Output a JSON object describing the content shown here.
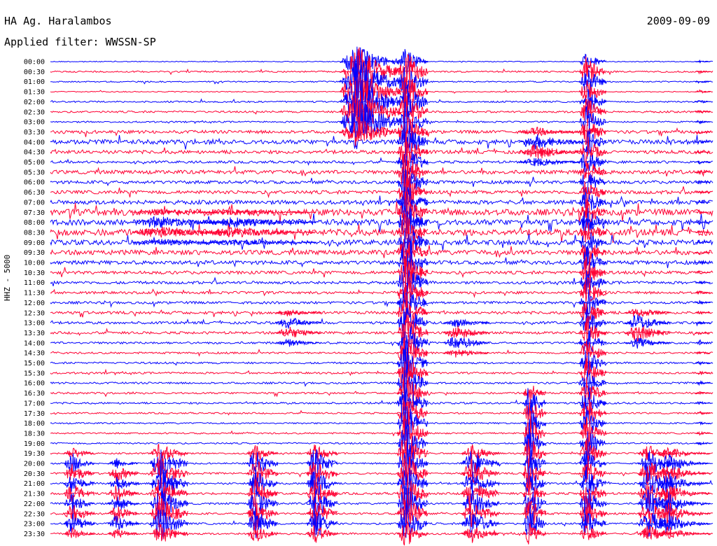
{
  "header": {
    "station": "HA Ag. Haralambos",
    "filter": "Applied filter: WWSSN-SP",
    "date": "2009-09-09"
  },
  "chart_data": {
    "type": "line",
    "title": "HA Ag. Haralambos",
    "subtitle": "Applied filter: WWSSN-SP",
    "ylabel": "HHZ - 5000",
    "date": "2009-09-09",
    "row_labels": [
      "00:00",
      "00:30",
      "01:00",
      "01:30",
      "02:00",
      "02:30",
      "03:00",
      "03:30",
      "04:00",
      "04:30",
      "05:00",
      "05:30",
      "06:00",
      "06:30",
      "07:00",
      "07:30",
      "08:00",
      "08:30",
      "09:00",
      "09:30",
      "10:00",
      "10:30",
      "11:00",
      "11:30",
      "12:00",
      "12:30",
      "13:00",
      "13:30",
      "14:00",
      "14:30",
      "15:00",
      "15:30",
      "16:00",
      "16:30",
      "17:00",
      "17:30",
      "18:00",
      "18:30",
      "19:00",
      "19:30",
      "20:00",
      "20:30",
      "21:00",
      "21:30",
      "22:00",
      "22:30",
      "23:00",
      "23:30"
    ],
    "row_minutes": 30,
    "x_range_minutes": [
      0,
      30
    ],
    "trace_colors": [
      "#0000ff",
      "#ff0033"
    ],
    "noise_level": [
      0.3,
      0.5,
      0.4,
      0.3,
      0.5,
      0.6,
      0.5,
      1.0,
      1.4,
      1.1,
      0.8,
      1.2,
      1.0,
      1.1,
      1.3,
      2.0,
      1.8,
      2.0,
      1.6,
      1.5,
      1.2,
      1.0,
      0.9,
      0.8,
      0.8,
      0.9,
      0.8,
      0.8,
      0.7,
      0.6,
      0.6,
      0.6,
      0.6,
      0.6,
      0.6,
      0.5,
      0.5,
      0.5,
      0.5,
      0.5,
      0.5,
      0.6,
      0.6,
      0.7,
      0.6,
      0.6,
      0.6,
      0.6
    ],
    "events": [
      {
        "minute": 13.9,
        "rows": [
          0,
          7
        ],
        "amp": 40,
        "width": 0.8
      },
      {
        "minute": 16.1,
        "rows": [
          0,
          47
        ],
        "amp": 35,
        "width": 0.4
      },
      {
        "minute": 24.3,
        "rows": [
          0,
          47
        ],
        "amp": 25,
        "width": 0.35
      },
      {
        "minute": 29.4,
        "rows": [
          0,
          47
        ],
        "amp": 3,
        "width": 0.2
      },
      {
        "minute": 5.0,
        "rows": [
          39,
          47
        ],
        "amp": 28,
        "width": 0.5
      },
      {
        "minute": 9.3,
        "rows": [
          39,
          47
        ],
        "amp": 24,
        "width": 0.4
      },
      {
        "minute": 12.0,
        "rows": [
          39,
          47
        ],
        "amp": 26,
        "width": 0.4
      },
      {
        "minute": 19.1,
        "rows": [
          39,
          47
        ],
        "amp": 22,
        "width": 0.5
      },
      {
        "minute": 21.7,
        "rows": [
          33,
          47
        ],
        "amp": 30,
        "width": 0.3
      },
      {
        "minute": 27.1,
        "rows": [
          39,
          47
        ],
        "amp": 22,
        "width": 0.5
      },
      {
        "minute": 28.0,
        "rows": [
          39,
          47
        ],
        "amp": 18,
        "width": 0.5
      },
      {
        "minute": 1.0,
        "rows": [
          39,
          47
        ],
        "amp": 16,
        "width": 0.4
      },
      {
        "minute": 3.0,
        "rows": [
          40,
          47
        ],
        "amp": 14,
        "width": 0.4
      },
      {
        "minute": 26.6,
        "rows": [
          25,
          28
        ],
        "amp": 14,
        "width": 0.6
      },
      {
        "minute": 10.8,
        "rows": [
          25,
          28
        ],
        "amp": 10,
        "width": 0.6
      },
      {
        "minute": 18.4,
        "rows": [
          26,
          29
        ],
        "amp": 12,
        "width": 0.6
      },
      {
        "minute": 4.9,
        "rows": [
          15,
          18
        ],
        "amp": 10,
        "width": 1.2
      },
      {
        "minute": 8.3,
        "rows": [
          15,
          18
        ],
        "amp": 8,
        "width": 1.5
      },
      {
        "minute": 22.0,
        "rows": [
          7,
          10
        ],
        "amp": 12,
        "width": 0.8
      }
    ]
  }
}
